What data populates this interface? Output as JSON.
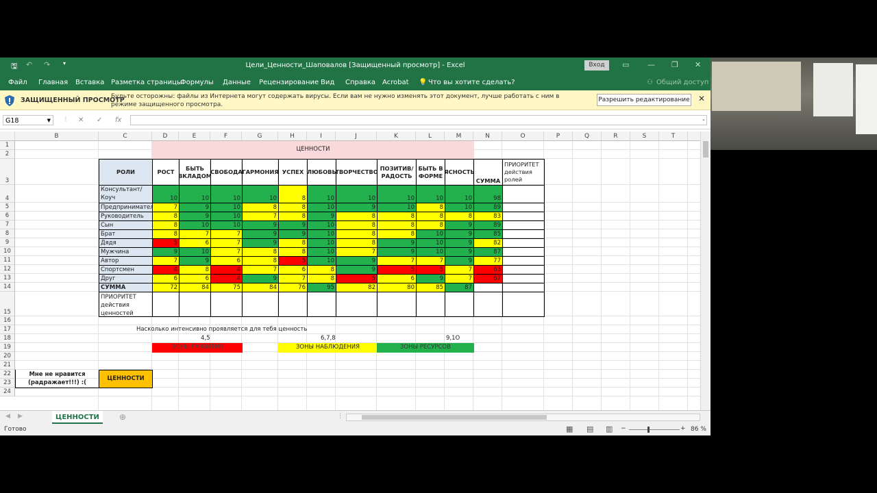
{
  "window": {
    "title": "Цели_Ценности_Шаповалов [Защищенный просмотр] - Excel",
    "signin": "Вход"
  },
  "ribbon": {
    "tabs": [
      "Файл",
      "Главная",
      "Вставка",
      "Разметка страницы",
      "Формулы",
      "Данные",
      "Рецензирование",
      "Вид",
      "Справка",
      "Acrobat"
    ],
    "tell": "Что вы хотите сделать?",
    "share": "Общий доступ"
  },
  "protected": {
    "title": "ЗАЩИЩЕННЫЙ ПРОСМОТР",
    "message": "Будьте осторожны: файлы из Интернета могут содержать вирусы. Если вам не нужно изменять этот документ, лучше работать с ним в режиме защищенного просмотра.",
    "button": "Разрешить редактирование"
  },
  "formula_bar": {
    "name_box": "G18",
    "formula": ""
  },
  "columns": [
    "B",
    "C",
    "D",
    "E",
    "F",
    "G",
    "H",
    "I",
    "J",
    "K",
    "L",
    "M",
    "N",
    "O",
    "P",
    "Q",
    "R",
    "S",
    "T",
    "U"
  ],
  "rows": [
    "1",
    "2",
    "3",
    "4",
    "5",
    "6",
    "7",
    "8",
    "9",
    "10",
    "11",
    "12",
    "13",
    "14",
    "15",
    "16",
    "17",
    "18",
    "19",
    "20",
    "21",
    "22",
    "23",
    "24"
  ],
  "sheet": {
    "values_header": "ЦЕННОСТИ",
    "roles_header": "РОЛИ",
    "value_cols": [
      "РОСТ",
      "БЫТЬ ВКЛАДОМ",
      "СВОБОДА",
      "ГАРМОНИЯ",
      "УСПЕХ",
      "ЛЮБОВЬ",
      "ТВОРЧЕСТВО",
      "ПОЗИТИВ/РАДОСТЬ",
      "БЫТЬ В ФОРМЕ",
      "ЯСНОСТЬ"
    ],
    "sum_header": "СУММА",
    "priority_header": "ПРИОРИТЕТ действия ролей",
    "roles": [
      {
        "name": "Консультант/Коуч",
        "values": [
          "10",
          "10",
          "10",
          "10",
          "8",
          "10",
          "10",
          "10",
          "10",
          "10"
        ],
        "sum": "98"
      },
      {
        "name": "Предприниматель",
        "values": [
          "7",
          "9",
          "10",
          "8",
          "8",
          "10",
          "9",
          "10",
          "8",
          "10"
        ],
        "sum": "89"
      },
      {
        "name": "Руководитель",
        "values": [
          "8",
          "9",
          "10",
          "7",
          "8",
          "9",
          "8",
          "8",
          "8",
          "8"
        ],
        "sum": "83"
      },
      {
        "name": "Сын",
        "values": [
          "8",
          "10",
          "10",
          "9",
          "9",
          "10",
          "8",
          "8",
          "8",
          "9"
        ],
        "sum": "89"
      },
      {
        "name": "Брат",
        "values": [
          "8",
          "7",
          "7",
          "9",
          "9",
          "10",
          "8",
          "8",
          "10",
          "9"
        ],
        "sum": "85"
      },
      {
        "name": "Дядя",
        "values": [
          "5",
          "6",
          "7",
          "9",
          "8",
          "10",
          "8",
          "9",
          "10",
          "9"
        ],
        "sum": "82"
      },
      {
        "name": "Мужчина",
        "values": [
          "9",
          "10",
          "7",
          "8",
          "8",
          "10",
          "7",
          "9",
          "10",
          "9"
        ],
        "sum": "87"
      },
      {
        "name": "Автор",
        "values": [
          "7",
          "9",
          "6",
          "8",
          "5",
          "10",
          "9",
          "7",
          "7",
          "9"
        ],
        "sum": "77"
      },
      {
        "name": "Спортсмен",
        "values": [
          "4",
          "8",
          "4",
          "7",
          "6",
          "8",
          "9",
          "5",
          "5",
          "7"
        ],
        "sum": "63"
      },
      {
        "name": "Друг",
        "values": [
          "6",
          "6",
          "4",
          "9",
          "7",
          "8",
          "5",
          "6",
          "9",
          "7"
        ],
        "sum": "67"
      }
    ],
    "sum_row": {
      "label": "СУММА",
      "values": [
        "72",
        "84",
        "75",
        "84",
        "76",
        "95",
        "82",
        "80",
        "85",
        "87"
      ]
    },
    "priority_row": "ПРИОРИТЕТ действия ценностей",
    "question": "Насколько интенсивно проявляется для тебя ценность (X) в роли (Y)?",
    "scale": [
      "4,5",
      "6,7,8",
      "9,1О"
    ],
    "zones": [
      "ЗОНЫ РАЗВИТИЯ",
      "ЗОНЫ НАБЛЮДЕНИЯ",
      "ЗОНЫ РЕСУРСОВ"
    ],
    "dislike": "Мне не нравится (радражает!!!) :(",
    "values_label2": "ЦЕННОСТИ"
  },
  "sheet_tab": "ЦЕННОСТИ",
  "status": {
    "ready": "Готово",
    "zoom": "86 %"
  },
  "colors": {
    "green": "#22b14c",
    "yellow": "#ffff00",
    "red": "#ff0000",
    "excel": "#217346"
  },
  "color_map": [
    [
      "g",
      "g",
      "g",
      "g",
      "y",
      "g",
      "g",
      "g",
      "g",
      "g",
      "g"
    ],
    [
      "y",
      "g",
      "g",
      "y",
      "y",
      "g",
      "g",
      "g",
      "y",
      "g",
      "g"
    ],
    [
      "y",
      "g",
      "g",
      "y",
      "y",
      "g",
      "y",
      "y",
      "y",
      "y",
      "y"
    ],
    [
      "y",
      "g",
      "g",
      "g",
      "g",
      "g",
      "y",
      "y",
      "y",
      "g",
      "g"
    ],
    [
      "y",
      "y",
      "y",
      "g",
      "g",
      "g",
      "y",
      "y",
      "g",
      "g",
      "g"
    ],
    [
      "r",
      "y",
      "y",
      "g",
      "y",
      "g",
      "y",
      "g",
      "g",
      "g",
      "y"
    ],
    [
      "g",
      "g",
      "y",
      "y",
      "y",
      "g",
      "y",
      "g",
      "g",
      "g",
      "g"
    ],
    [
      "y",
      "g",
      "y",
      "y",
      "r",
      "g",
      "g",
      "y",
      "y",
      "g",
      "y"
    ],
    [
      "r",
      "y",
      "r",
      "y",
      "y",
      "y",
      "g",
      "r",
      "r",
      "y",
      "r"
    ],
    [
      "y",
      "y",
      "r",
      "g",
      "y",
      "y",
      "r",
      "y",
      "g",
      "y",
      "r"
    ]
  ],
  "sum_colors": [
    "y",
    "y",
    "y",
    "y",
    "y",
    "g",
    "y",
    "y",
    "y",
    "g"
  ]
}
